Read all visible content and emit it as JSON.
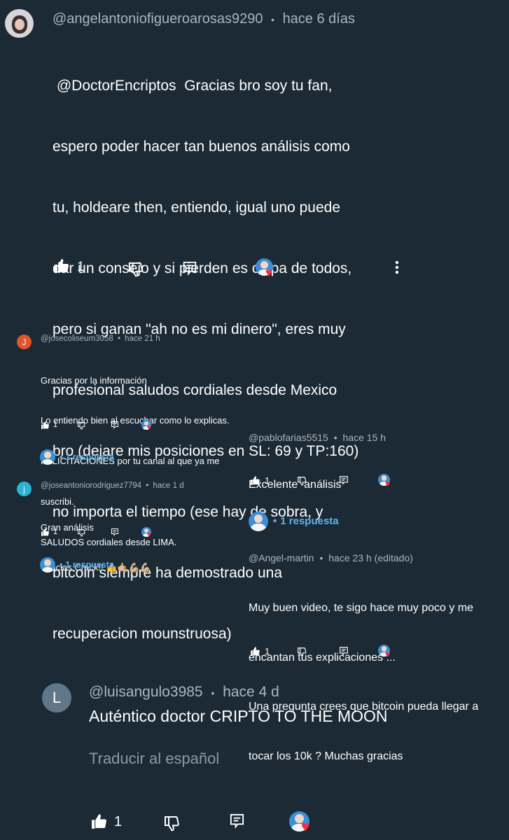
{
  "main_comment": {
    "author": "@angelantoniofigueroarosas9290",
    "time": "hace 6 días",
    "lines": [
      " @DoctorEncriptos  Gracias bro soy tu fan,",
      "espero poder hacer tan buenos análisis como",
      "tu, holdeare then, entiendo, igual uno puede",
      "dar un consejo y si pierden es culpa de todos,",
      "pero si ganan \"ah no es mi dinero\", eres muy",
      "profesional saludos cordiales desde Mexico",
      "bro (dejare mis posiciones en SL: 69 y TP:160)",
      "no importa el tiempo (ese hay de sobra, y",
      "bitcoin siempre ha demostrado una",
      "recuperacion mounstruosa)"
    ],
    "likes": "1"
  },
  "comment_jose": {
    "avatar_letter": "J",
    "author": "@josecoliseum3058",
    "time": "hace 21 h",
    "lines": [
      "Gracias por la información",
      "Lo entiendo bien al escuchar como lo explicas.",
      "FELICITACIONES por tu canal al que ya me",
      "suscribi.",
      "SALUDOS cordiales desde LIMA."
    ],
    "likes": "1",
    "reply_label": "1 respuesta"
  },
  "comment_joseantonio": {
    "avatar_letter": "j",
    "author": "@joseantoniorodriguez7794",
    "time": "hace 1 d",
    "lines": [
      "Gran análisis",
      "Gracias Crack!! 👍🤙🏼💪🏼💪🏼"
    ],
    "likes": "1",
    "reply_label": "1 respuesta"
  },
  "comment_pablo": {
    "author": "@pablofarias5515",
    "time": "hace 15 h",
    "lines": [
      "Excelente  análisis"
    ],
    "likes": "1",
    "reply_label": "1 respuesta"
  },
  "comment_angel": {
    "author": "@Angel-martin",
    "time": "hace 23 h (editado)",
    "lines": [
      "Muy buen video, te sigo hace muy poco y me",
      "encantan tus explicaciones ...",
      "Una pregunta crees que bitcoin pueda llegar a",
      "tocar los 10k ? Muchas gracias"
    ],
    "likes": "1"
  },
  "comment_luis": {
    "avatar_letter": "L",
    "author": "@luisangulo3985",
    "time": "hace 4 d",
    "text": "Auténtico doctor CRIPTO TO THE MOON",
    "translate": "Traducir al español",
    "likes": "1"
  },
  "separator": "•",
  "colors": {
    "background": "#1c2a35",
    "link": "#58b3f5",
    "heart": "#ff2a3a",
    "avatar_j1": "#e0542e",
    "avatar_j2": "#29b3d6",
    "avatar_l": "#5f7788"
  },
  "icons": [
    "thumb-up-icon",
    "thumb-down-icon",
    "reply-icon",
    "creator-heart-icon",
    "more-icon"
  ]
}
